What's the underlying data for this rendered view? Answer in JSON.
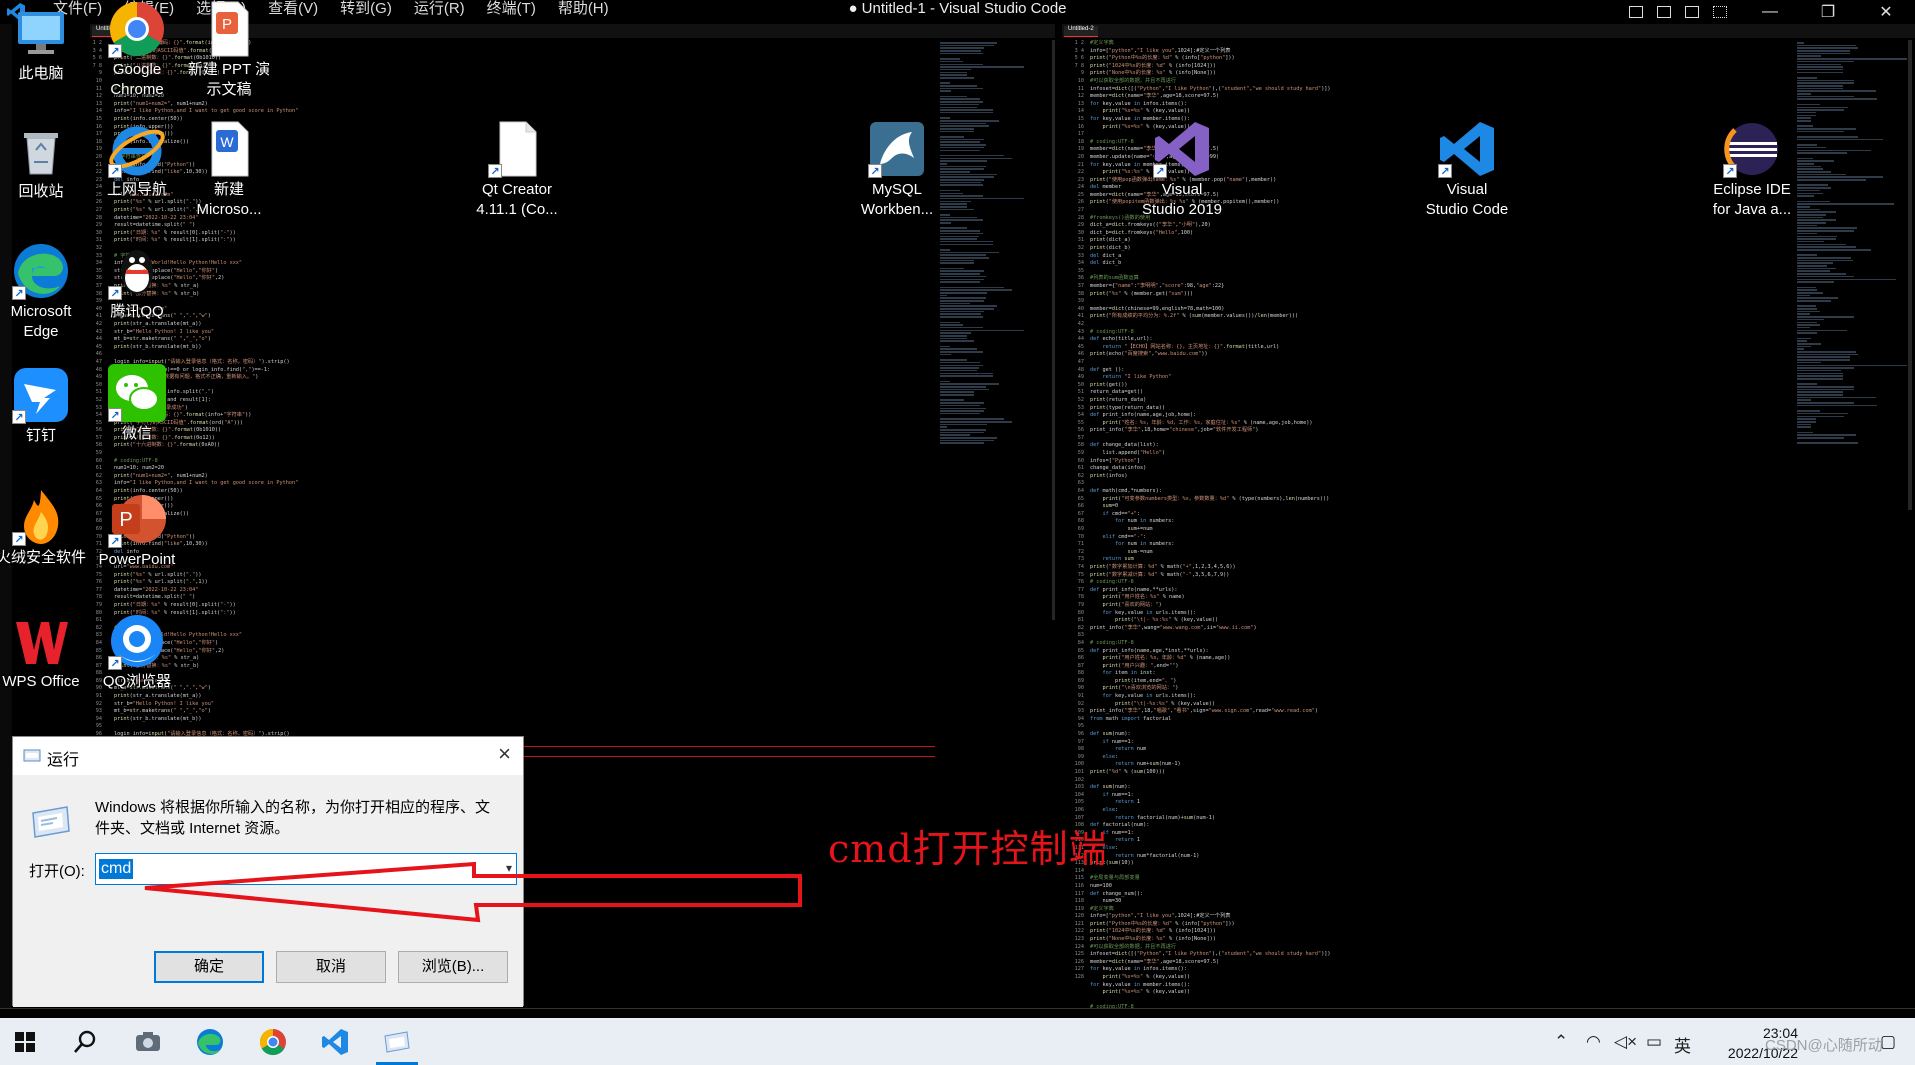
{
  "window": {
    "title": "● Untitled-1 - Visual Studio Code",
    "menus": [
      "文件(F)",
      "编辑(E)",
      "选择(S)",
      "查看(V)",
      "转到(G)",
      "运行(R)",
      "终端(T)",
      "帮助(H)"
    ],
    "controls": {
      "minimize": "—",
      "maximize": "❐",
      "close": "✕"
    }
  },
  "editor": {
    "left_tab": "Untitled-1",
    "right_tab": "Untitled-2",
    "left_code": [
      "print(\"UNICODE编码：{}\".format(info+\"字符串\"))",
      "print(\"字符{}的ASCII码值\".format(ord(\"A\")))",
      "print(\"二进制数：{}\".format(0b1010))",
      "print(\"八进制数：{}\".format(0o12))",
      "print(\"十六进制数：{}\".format(0xA0))",
      "",
      "# coding:UTF-8",
      "num1=10; num2=20",
      "print(\"num1+num2=\", num1+num2)",
      "info=\"I like Python,and I want to get good score in Python\"",
      "print(info.center(50))",
      "print(info.upper())",
      "print(info.lower())",
      "print(info.capitalize())",
      "",
      "# 字符串查找",
      "print(info.find(\"Python\"))",
      "print(info.find(\"like\",10,30))",
      "del info",
      "",
      "url=\"www.baidu.com\"",
      "print(\"%s\" % url.split(\".\"))",
      "print(\"%s\" % url.split(\".\",1))",
      "datetime=\"2022-10-22 23:04\"",
      "result=datetime.split(\" \")",
      "print(\"日期：%s\" % result[0].split(\"-\"))",
      "print(\"时间：%s\" % result[1].split(\":\"))",
      "",
      "# 字符串替换",
      "info=\"Hello World!Hello Python!Hello xxx\"",
      "str_a=info.replace(\"Hello\",\"你好\")",
      "str_b=info.replace(\"Hello\",\"你好\",2)",
      "print(\"全部替换：%s\" % str_a)",
      "print(\"部分替换：%s\" % str_b)",
      "",
      "str_a=\"www.i.com\"",
      "mt_a=str.maketrans(\" \",\".\",\"w\")",
      "print(str_a.translate(mt_a))",
      "str_b=\"Hello Python! I like you\"",
      "mt_b=str.maketrans(\" \",\"_\",\"o\")",
      "print(str_b.translate(mt_b))",
      "",
      "login_info=input(\"请输入登录信息（格式：名称，密码）\").strip()",
      "if len(login_info)==0 or login_info.find(\",\")==-1:",
      "    print(\"输入的数据有问题，格式不正确，重新输入。\")",
      "else:",
      "    result=login_info.split(\",\")",
      "    if result[0] and result[1]:",
      "        print(\"登录成功\")"
    ],
    "right_code": [
      "#定义字典",
      "info=[\"python\",\"I like you\",1024];#定义一个列表",
      "print(\"Python中%s的长度：%d\" % (info[\"python\"]))",
      "print(\"1024中%s的长度：%d\" % (info[1024]))",
      "print(\"None中%s的长度：%s\" % (info[None]))",
      "#可以获取全部的数据，并且不再进行",
      "infoset=dict([(\"Python\",\"I like Python\"),(\"student\",\"we should study hard\")])",
      "member=dict(name=\"李华\",age=18,score=97.5)",
      "for key,value in infos.items():",
      "    print(\"%s=%s\" % (key,value))",
      "for key,value in member.items():",
      "    print(\"%s=%s\" % (key,value))",
      "",
      "# coding:UTF-8",
      "member=dict(name=\"李华\",age=18,score=97.5)",
      "member.update(name=\"小李\",age=20,score=99)",
      "for key,value in member.items():",
      "    print(\"%s:%s\" % (key,value))",
      "print(\"使用pop函数弹出name：%s\" % (member.pop(\"name\"),member))",
      "del member",
      "member=dict(name=\"李华\",age=18,score=97.5)",
      "print(\"使用popitem函数弹出：%s %s\" % (member.popitem(),member))",
      "",
      "#fromkeys()函数的使用",
      "dict_a=dict.fromkeys((\"李华\",\"小明\"),20)",
      "dict_b=dict.fromkeys(\"Hello\",100)",
      "print(dict_a)",
      "print(dict_b)",
      "del dict_a",
      "del dict_b",
      "",
      "#列表的sum函数运算",
      "member={\"name\":\"李明明\",\"score\":98,\"age\":22}",
      "print(\"%s\" % (member.get(\"sum\")))",
      "",
      "member=dict(chinese=99,english=78,math=100)",
      "print(\"所有成绩的平均分为：%.2f\" % (sum(member.values())/len(member)))",
      "",
      "# coding:UTF-8",
      "def echo(title,url):",
      "    return \"【ECHO】网站名称：{}，主页地址：{}\".format(title,url)",
      "print(echo(\"百度搜索\",\"www.baidu.com\"))",
      "",
      "def get ():",
      "    return \"I like Python\"",
      "print(get())",
      "return_data=get()",
      "print(return_data)",
      "print(type(return_data))",
      "def print_info(name,age,job,home):",
      "    print(\"姓名：%s，年龄：%d，工作：%s，家庭住址：%s\" % (name,age,job,home))",
      "print_info(\"李华\",18,home=\"chinese\",job=\"软件开发工程师\")",
      "",
      "def change_data(list):",
      "    list.append(\"Hello\")",
      "infos=[\"Python\"]",
      "change_data(infos)",
      "print(infos)",
      "",
      "def math(cmd,*numbers):",
      "    print(\"可变参数numbers类型：%s，参数数量：%d\" % (type(numbers),len(numbers)))",
      "    sum=0",
      "    if cmd==\"+\":",
      "        for num in numbers:",
      "            sum+=num",
      "    elif cmd==\"-\":",
      "        for num in numbers:",
      "            sum-=num",
      "    return sum",
      "print(\"数字累加计算：%d\" % math(\"+\",1,2,3,4,5,6))",
      "print(\"数字累减计算：%d\" % math(\"-\",3,5,6,7,9))",
      "# coding:UTF-8",
      "def print_info(name,**urls):",
      "    print(\"用户姓名：%s\" % name)",
      "    print(\"喜欢的网站：\")",
      "    for key,value in urls.items():",
      "        print(\"\\t|- %s:%s\" % (key,value))",
      "print_info(\"李华\",wang=\"www.wang.com\",ii=\"www.ii.com\")",
      "",
      "# coding:UTF-8",
      "def print_info(name,age,*inst,**urls):",
      "    print(\"用户姓名：%s，年龄：%d\" % (name,age))",
      "    print(\"用户兴趣：\",end=\"\")",
      "    for item in inst:",
      "        print(item,end=\"、\")",
      "    print(\"\\n喜欢浏览的网站：\")",
      "    for key,value in urls.items():",
      "        print(\"\\t|-%s:%s\" % (key,value))",
      "print_info(\"李华\",18,\"唱歌\",\"看书\",sign=\"www.sign.com\",read=\"www.read.com\")",
      "from math import factorial",
      "",
      "def sum(num):",
      "    if num==1:",
      "        return num",
      "    else:",
      "        return num+sum(num-1)",
      "print(\"%d\" % (sum(100)))",
      "",
      "def sum(num):",
      "    if num==1:",
      "        return 1",
      "    else:",
      "        return factorial(num)+sum(num-1)",
      "def factorial(num):",
      "    if num==1:",
      "        return 1",
      "    else:",
      "        return num*factorial(num-1)",
      "print(sum(10))",
      "",
      "#全局变量与局部变量",
      "num=100",
      "def change_num():",
      "    num=30"
    ]
  },
  "desktop_icons": [
    {
      "name": "this-pc",
      "label1": "此电脑",
      "label2": ""
    },
    {
      "name": "recycle-bin",
      "label1": "回收站",
      "label2": ""
    },
    {
      "name": "edge",
      "label1": "Microsoft",
      "label2": "Edge"
    },
    {
      "name": "dingtalk",
      "label1": "钉钉",
      "label2": ""
    },
    {
      "name": "huorong",
      "label1": "火绒安全软件",
      "label2": ""
    },
    {
      "name": "wps",
      "label1": "WPS Office",
      "label2": ""
    },
    {
      "name": "chrome",
      "label1": "Google",
      "label2": "Chrome"
    },
    {
      "name": "ppt-new",
      "label1": "新建 PPT 演",
      "label2": "示文稿"
    },
    {
      "name": "ie",
      "label1": "上网导航",
      "label2": ""
    },
    {
      "name": "word-new",
      "label1": "新建",
      "label2": "Microso..."
    },
    {
      "name": "qq",
      "label1": "腾讯QQ",
      "label2": ""
    },
    {
      "name": "wechat",
      "label1": "微信",
      "label2": ""
    },
    {
      "name": "powerpoint",
      "label1": "PowerPoint",
      "label2": ""
    },
    {
      "name": "qq-browser",
      "label1": "QQ浏览器",
      "label2": ""
    },
    {
      "name": "qt-creator",
      "label1": "Qt Creator",
      "label2": "4.11.1 (Co..."
    },
    {
      "name": "mysql-workbench",
      "label1": "MySQL",
      "label2": "Workben..."
    },
    {
      "name": "visual-studio",
      "label1": "Visual",
      "label2": "Studio 2019"
    },
    {
      "name": "vscode",
      "label1": "Visual",
      "label2": "Studio Code"
    },
    {
      "name": "eclipse",
      "label1": "Eclipse IDE",
      "label2": "for Java a..."
    }
  ],
  "run_dialog": {
    "title": "运行",
    "description": "Windows 将根据你所输入的名称，为你打开相应的程序、文件夹、文档或 Internet 资源。",
    "open_label": "打开(O):",
    "input_value": "cmd",
    "ok": "确定",
    "cancel": "取消",
    "browse": "浏览(B)..."
  },
  "annotation": "cmd打开控制端",
  "taskbar": {
    "ime": "英",
    "time": "23:04",
    "date": "2022/10/22",
    "watermark": "CSDN@心随所动"
  },
  "colors": {
    "accent": "#0078d7",
    "annotation_red": "#e5141b",
    "code_keyword": "#569cd6",
    "code_string": "#ce9178",
    "code_comment": "#6a9955",
    "code_function": "#dcdcaa"
  }
}
